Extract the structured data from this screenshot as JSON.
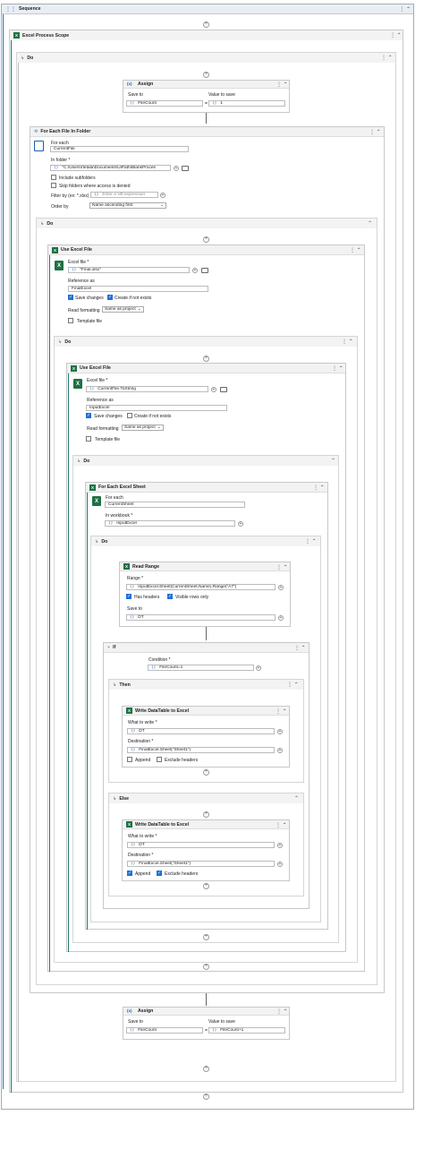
{
  "sequence": {
    "title": "Sequence"
  },
  "excel_scope": {
    "title": "Excel Process Scope",
    "do_label": "Do"
  },
  "assign1": {
    "title": "Assign",
    "save_to_label": "Save to",
    "value_label": "Value to save",
    "save_to": "FileCount",
    "value": "1",
    "eq": "="
  },
  "foreach_folder": {
    "title": "For Each File In Folder",
    "for_each_label": "For each",
    "for_each_value": "CurrentFile",
    "in_folder_label": "In folder *",
    "in_folder_value": "\"C:\\Users\\rtetala\\Documents\\UiPath\\BlankProces",
    "include_sub": "Include subfolders",
    "skip_denied": "Skip folders where access is denied",
    "filter_label": "Filter by (ex: *.xlsx)",
    "filter_placeholder": "Enter a VB expression",
    "order_label": "Order by",
    "order_value": "Name ascending first",
    "do_label": "Do"
  },
  "use_excel1": {
    "title": "Use Excel File",
    "file_label": "Excel file *",
    "file_value": "\"Final.xlsx\"",
    "ref_label": "Reference as",
    "ref_value": "FinalExcel",
    "save_changes": "Save changes",
    "create": "Create if not exists",
    "read_fmt_label": "Read formatting",
    "read_fmt_value": "Same as project",
    "template": "Template file",
    "do_label": "Do"
  },
  "use_excel2": {
    "title": "Use Excel File",
    "file_label": "Excel file *",
    "file_value": "CurrentFile.ToString",
    "ref_label": "Reference as",
    "ref_value": "InputExcel",
    "save_changes": "Save changes",
    "create": "Create if not exists",
    "read_fmt_label": "Read formatting",
    "read_fmt_value": "Same as project",
    "template": "Template file",
    "do_label": "Do"
  },
  "foreach_sheet": {
    "title": "For Each Excel Sheet",
    "for_each_label": "For each",
    "for_each_value": "CurrentSheet",
    "workbook_label": "In workbook *",
    "workbook_value": "InputExcel",
    "do_label": "Do"
  },
  "read_range": {
    "title": "Read Range",
    "range_label": "Range *",
    "range_value": "InputExcel.Sheet(CurrentSheet.Name).Range(\"A7\")",
    "has_headers": "Has headers",
    "visible_rows": "Visible rows only",
    "save_label": "Save to",
    "save_value": "DT"
  },
  "if_block": {
    "title": "If",
    "cond_label": "Condition *",
    "cond_value": "FileCount=1",
    "then": "Then",
    "else": "Else"
  },
  "write1": {
    "title": "Write DataTable to Excel",
    "what_label": "What to write *",
    "what_value": "DT",
    "dest_label": "Destination *",
    "dest_value": "FinalExcel.Sheet(\"Sheet1\")",
    "append": "Append",
    "exclude": "Exclude headers"
  },
  "write2": {
    "title": "Write DataTable to Excel",
    "what_label": "What to write *",
    "what_value": "DT",
    "dest_label": "Destination *",
    "dest_value": "FinalExcel.Sheet(\"Sheet1\")",
    "append": "Append",
    "exclude": "Exclude headers"
  },
  "assign2": {
    "title": "Assign",
    "save_to_label": "Save to",
    "value_label": "Value to save",
    "save_to": "FileCount",
    "value": "FileCount+1",
    "eq": "="
  },
  "icons": {
    "plus": "add-activity-icon",
    "collapse": "collapse-icon",
    "menu": "kebab-menu-icon"
  },
  "colors": {
    "accent": "#1e7a6e",
    "excel": "#1e7145",
    "blue": "#1e6fd9"
  }
}
